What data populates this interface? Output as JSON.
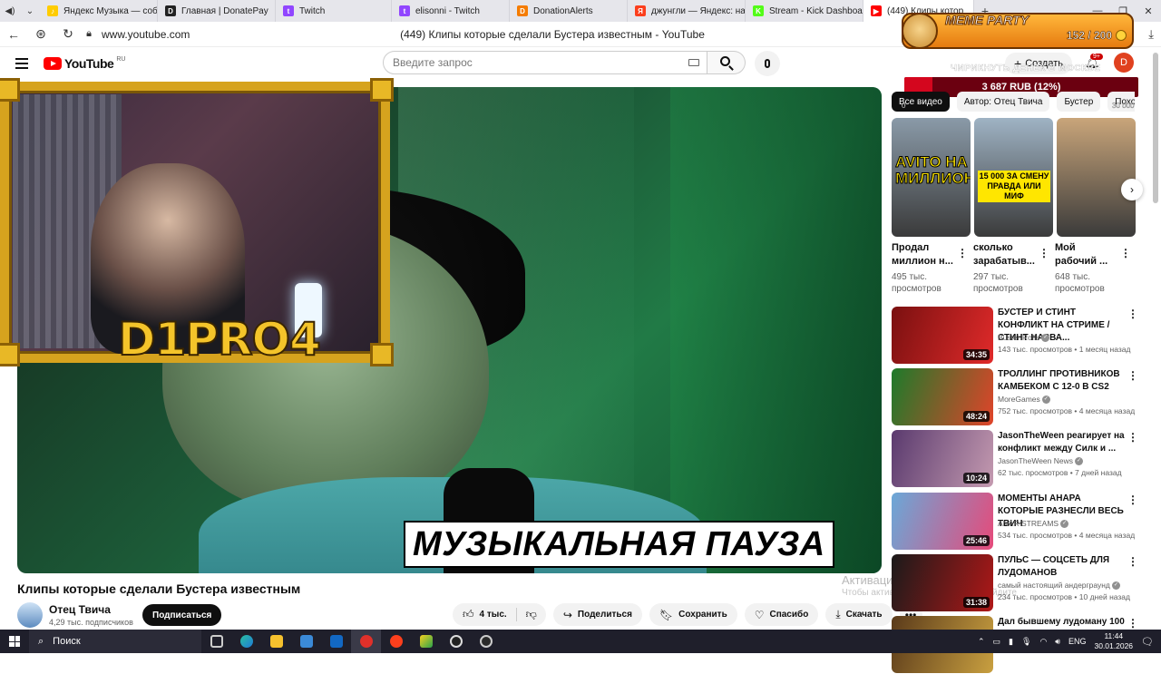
{
  "browser": {
    "tabs": [
      {
        "label": "Яндекс Музыка — собир",
        "color": "#ffcc00",
        "glyph": "♪"
      },
      {
        "label": "Главная | DonatePay",
        "color": "#222222",
        "glyph": "D"
      },
      {
        "label": "Twitch",
        "color": "#9146ff",
        "glyph": "t"
      },
      {
        "label": "elisonni - Twitch",
        "color": "#9146ff",
        "glyph": "t"
      },
      {
        "label": "DonationAlerts",
        "color": "#f57c00",
        "glyph": "D"
      },
      {
        "label": "джунгли — Яндекс: наш",
        "color": "#fc3f1d",
        "glyph": "Я"
      },
      {
        "label": "Stream - Kick Dashboard",
        "color": "#53fc18",
        "glyph": "K"
      },
      {
        "label": "(449) Клипы котор",
        "color": "#ff0000",
        "glyph": "▶",
        "active": true
      }
    ],
    "url": "www.youtube.com",
    "page_title": "(449) Клипы которые сделали Бустера известным - YouTube"
  },
  "header": {
    "logo_text": "YouTube",
    "logo_region": "RU",
    "search_placeholder": "Введите запрос",
    "create_label": "Создать",
    "notifications_badge": "9+",
    "avatar_letter": "D"
  },
  "video": {
    "caption": "МУЗЫКАЛЬНАЯ ПАУЗА",
    "cam_label": "D1PRO4",
    "title": "Клипы которые сделали Бустера известным",
    "channel": "Отец Твича",
    "subscribers": "4,29 тыс. подписчиков",
    "subscribe_label": "Подписаться",
    "likes": "4 тыс.",
    "share_label": "Поделиться",
    "save_label": "Сохранить",
    "thanks_label": "Спасибо",
    "download_label": "Скачать"
  },
  "overlay": {
    "meme_title": "MEME PARTY",
    "meme_count": "152 / 200",
    "goal_title": "ЧИРИКНУТЬ ДЕНЕК В МОСКВЕ",
    "goal_text": "3 687 RUB (12%)",
    "goal_fraction": 0.12,
    "goal_left": "0",
    "goal_right": "30 000"
  },
  "activation": {
    "title": "Активация",
    "subtitle": "Чтобы активировать Windows, перейдите"
  },
  "chips": [
    "Все видео",
    "Автор: Отец Твича",
    "Бустер",
    "Похожи"
  ],
  "shorts": [
    {
      "title": "Продал миллион н...",
      "views": "495 тыс. просмотров",
      "overlay": "AVITO НА МИЛЛИОН",
      "bg": "#8a9aa8"
    },
    {
      "title": "сколько зарабатыв...",
      "views": "297 тыс. просмотров",
      "overlay": "15 000 ЗА СМЕНУ ПРАВДА ИЛИ МИФ",
      "bg": "#9fb3c4"
    },
    {
      "title": "Мой рабочий ...",
      "views": "648 тыс. просмотров",
      "overlay": "",
      "bg": "#c9a57a"
    }
  ],
  "recommended": [
    {
      "title": "БУСТЕР И СТИНТ КОНФЛИКТ НА СТРИМЕ / СТИНТ НАЗВА...",
      "channel": "Buster Rofls",
      "meta": "143 тыс. просмотров • 1 месяц назад",
      "duration": "34:35",
      "bg1": "#7a1010",
      "bg2": "#e02a2a"
    },
    {
      "title": "ТРОЛЛИНГ ПРОТИВНИКОВ КАМБЕКОМ С 12-0 В CS2",
      "channel": "MoreGames",
      "meta": "752 тыс. просмотров • 4 месяца назад",
      "duration": "48:24",
      "bg1": "#1d7a2a",
      "bg2": "#e0442a"
    },
    {
      "title": "JasonTheWeen реагирует на конфликт между Силк и ...",
      "channel": "JasonTheWeen News",
      "meta": "62 тыс. просмотров • 7 дней назад",
      "duration": "10:24",
      "bg1": "#5a3a6e",
      "bg2": "#c49ab0"
    },
    {
      "title": "МОМЕНТЫ АНАРА КОТОРЫЕ РАЗНЕСЛИ ВЕСЬ ТВИЧ",
      "channel": "ANAR STREAMS",
      "meta": "534 тыс. просмотров • 4 месяца назад",
      "duration": "25:46",
      "bg1": "#6aa8d8",
      "bg2": "#e64a7a"
    },
    {
      "title": "ПУЛЬС — СОЦСЕТЬ ДЛЯ ЛУДОМАНОВ",
      "channel": "самый настоящий андерграунд",
      "meta": "234 тыс. просмотров • 10 дней назад",
      "duration": "31:38",
      "bg1": "#1a1a1a",
      "bg2": "#b01818"
    },
    {
      "title": "Дал бывшему лудоману 100",
      "channel": "",
      "meta": "",
      "duration": "",
      "bg1": "#5a3a1a",
      "bg2": "#c9a040"
    }
  ],
  "taskbar": {
    "search_label": "Поиск",
    "lang": "ENG",
    "time": "11:44",
    "date": "30.01.2026"
  }
}
